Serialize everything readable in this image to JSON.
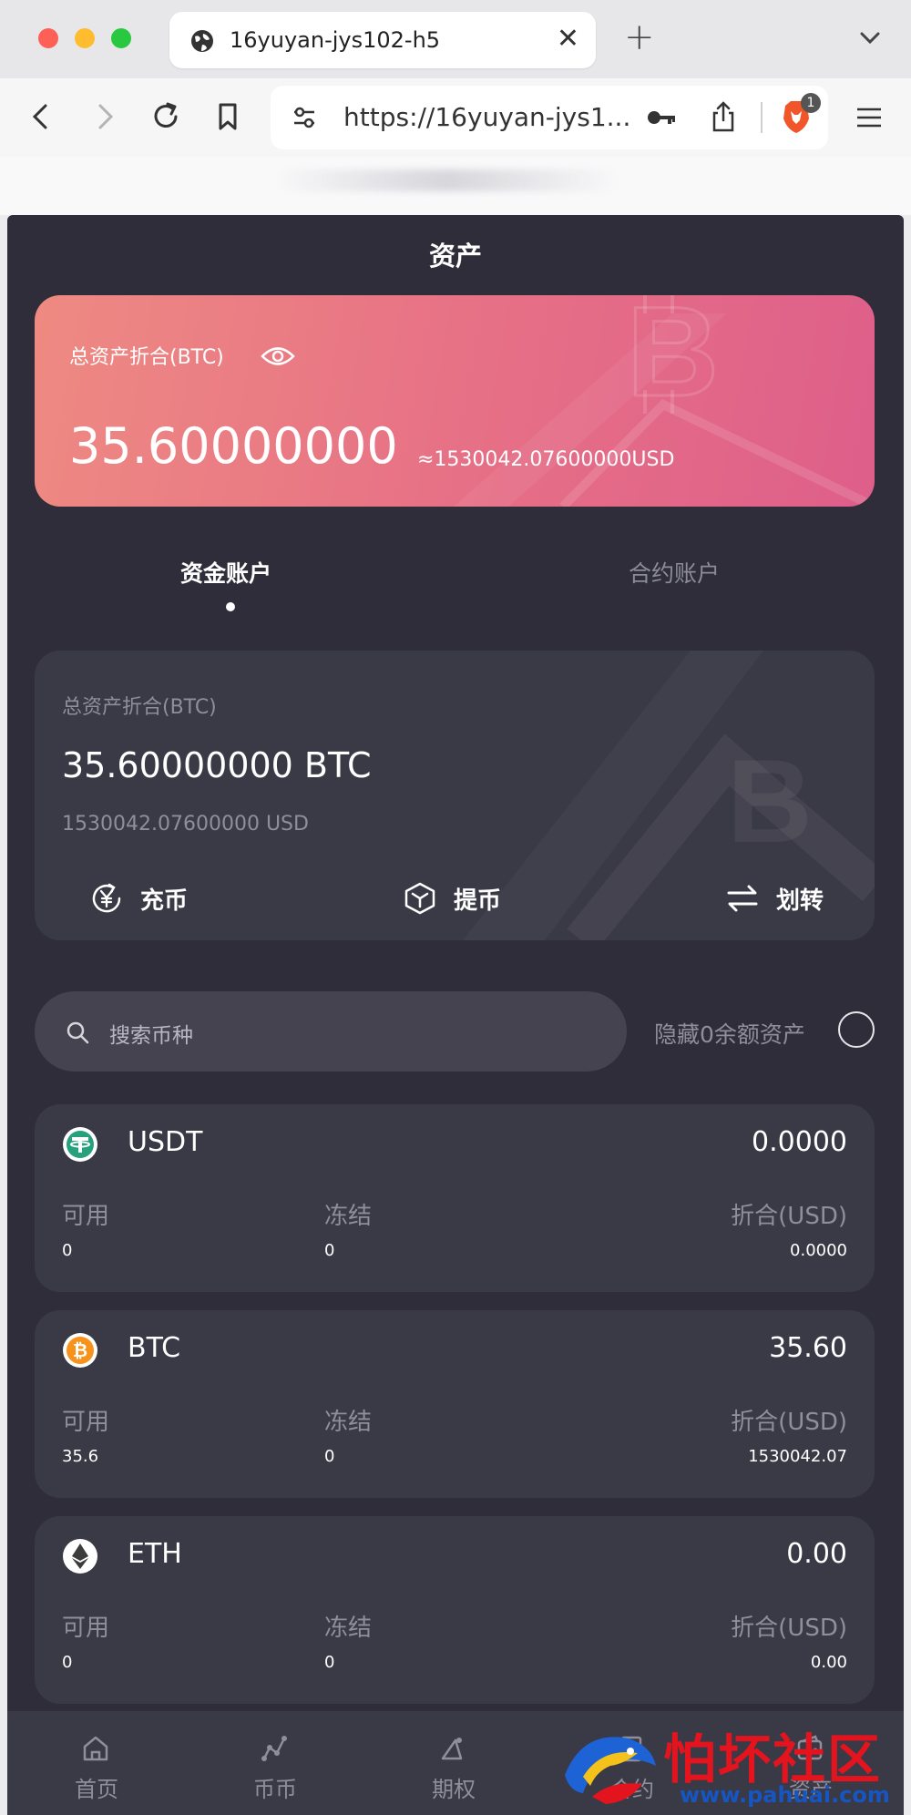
{
  "browser": {
    "tab_title": "16yuyan-jys102-h5",
    "tab_close": "✕",
    "new_tab": "+",
    "address": "https://16yuyan-jys1...",
    "brave_badge": "1"
  },
  "app": {
    "page_title": "资产",
    "hero": {
      "label": "总资产折合(BTC)",
      "value": "35.60000000",
      "usd": "≈1530042.07600000USD"
    },
    "tabs": [
      {
        "label": "资金账户",
        "active": true
      },
      {
        "label": "合约账户",
        "active": false
      }
    ],
    "fund": {
      "label": "总资产折合(BTC)",
      "value": "35.60000000 BTC",
      "usd": "1530042.07600000 USD",
      "actions": [
        {
          "icon": "deposit-yen-icon",
          "label": "充币"
        },
        {
          "icon": "withdraw-cube-icon",
          "label": "提币"
        },
        {
          "icon": "transfer-arrows-icon",
          "label": "划转"
        }
      ]
    },
    "search": {
      "placeholder": "搜索币种"
    },
    "hide_zero_label": "隐藏0余额资产",
    "column_headers": {
      "available": "可用",
      "frozen": "冻结",
      "usd": "折合(USD)"
    },
    "coins": [
      {
        "name": "USDT",
        "total": "0.0000",
        "available": "0",
        "frozen": "0",
        "usd": "0.0000",
        "logo_color": "#26a17b"
      },
      {
        "name": "BTC",
        "total": "35.60",
        "available": "35.6",
        "frozen": "0",
        "usd": "1530042.07",
        "logo_color": "#f7931a"
      },
      {
        "name": "ETH",
        "total": "0.00",
        "available": "0",
        "frozen": "0",
        "usd": "0.00",
        "logo_color": "#3c3c3d"
      }
    ],
    "bottom_nav": [
      {
        "icon": "home-icon",
        "label": "首页"
      },
      {
        "icon": "market-icon",
        "label": "币币"
      },
      {
        "icon": "options-icon",
        "label": "期权"
      },
      {
        "icon": "contract-icon",
        "label": "合约"
      },
      {
        "icon": "assets-icon",
        "label": "资产"
      }
    ]
  },
  "watermark": {
    "text": "怕坏社区",
    "url": "www.pahuai.com"
  }
}
